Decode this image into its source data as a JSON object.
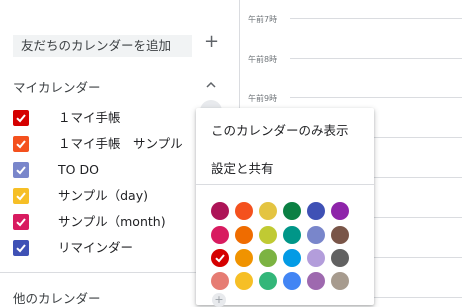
{
  "sidebar": {
    "add_friend_calendar": "友だちのカレンダーを追加",
    "add_icon": "plus-icon",
    "my_calendars_title": "マイカレンダー",
    "other_calendars_title": "他のカレンダー",
    "calendars": [
      {
        "label": "１マイ手帳",
        "color": "#d50000",
        "checked": true
      },
      {
        "label": "１マイ手帳　サンプル",
        "color": "#f4511e",
        "checked": true
      },
      {
        "label": "TO DO",
        "color": "#7986cb",
        "checked": true
      },
      {
        "label": "サンプル（day)",
        "color": "#f6bf26",
        "checked": true
      },
      {
        "label": "サンプル（month)",
        "color": "#d81b60",
        "checked": true
      },
      {
        "label": "リマインダー",
        "color": "#3f51b5",
        "checked": true
      }
    ]
  },
  "grid": {
    "hours": [
      "午前7時",
      "午前8時",
      "午前9時"
    ]
  },
  "menu": {
    "show_only": "このカレンダーのみ表示",
    "settings_share": "設定と共有",
    "selected_color": "#d50000",
    "palette": [
      [
        "#ad1457",
        "#f4511e",
        "#e4c441",
        "#0b8043",
        "#3f51b5",
        "#8e24aa"
      ],
      [
        "#d81b60",
        "#ef6c00",
        "#c0ca33",
        "#009688",
        "#7986cb",
        "#795548"
      ],
      [
        "#d50000",
        "#f09300",
        "#7cb342",
        "#039be5",
        "#b39ddb",
        "#616161"
      ],
      [
        "#e67c73",
        "#f6bf26",
        "#33b679",
        "#4285f4",
        "#9e69af",
        "#a79b8e"
      ]
    ],
    "add_color_icon": "plus-icon"
  }
}
